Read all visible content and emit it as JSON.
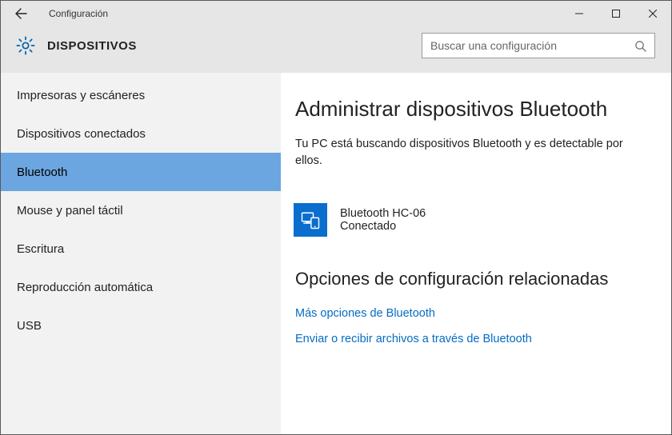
{
  "window": {
    "title": "Configuración"
  },
  "header": {
    "section": "DISPOSITIVOS",
    "search_placeholder": "Buscar una configuración"
  },
  "sidebar": {
    "items": [
      {
        "label": "Impresoras y escáneres",
        "selected": false
      },
      {
        "label": "Dispositivos conectados",
        "selected": false
      },
      {
        "label": "Bluetooth",
        "selected": true
      },
      {
        "label": "Mouse y panel táctil",
        "selected": false
      },
      {
        "label": "Escritura",
        "selected": false
      },
      {
        "label": "Reproducción automática",
        "selected": false
      },
      {
        "label": "USB",
        "selected": false
      }
    ]
  },
  "content": {
    "heading": "Administrar dispositivos Bluetooth",
    "status_text": "Tu PC está buscando dispositivos Bluetooth y es detectable por ellos.",
    "device": {
      "name": "Bluetooth HC-06",
      "status": "Conectado"
    },
    "related_heading": "Opciones de configuración relacionadas",
    "links": [
      "Más opciones de Bluetooth",
      "Enviar o recibir archivos a través de Bluetooth"
    ]
  }
}
